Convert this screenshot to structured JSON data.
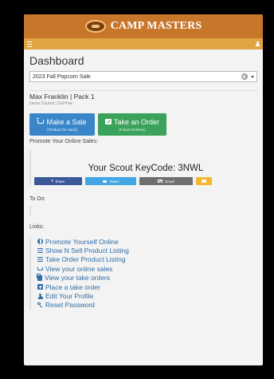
{
  "header": {
    "brand": "CAMP MASTERS"
  },
  "page": {
    "title": "Dashboard"
  },
  "sale_select": {
    "value": "2023 Fall Popcorn Sale"
  },
  "scout": {
    "name": "Max Franklin | Pack 1",
    "council": "Demo Council | Tall Pine"
  },
  "actions": {
    "make_sale": {
      "label": "Make a Sale",
      "sub": "(Product On Hand)"
    },
    "take_order": {
      "label": "Take an Order",
      "sub": "(Future Delivery)"
    }
  },
  "promote": {
    "label": "Promote Your Online Sales:",
    "keycode": "Your Scout KeyCode: 3NWL",
    "share_facebook": "Share",
    "share_twitter": "Tweet",
    "share_email": "Email"
  },
  "todo": {
    "label": "To Do:"
  },
  "links": {
    "label": "Links:",
    "items": [
      {
        "label": "Promote Yourself Online",
        "icon": "globe-icon"
      },
      {
        "label": "Show N Sell Product Listing",
        "icon": "list-icon"
      },
      {
        "label": "Take Order Product Listing",
        "icon": "list-icon"
      },
      {
        "label": "View your online sales",
        "icon": "cart-icon"
      },
      {
        "label": "View your take orders",
        "icon": "documents-icon"
      },
      {
        "label": "Place a take order",
        "icon": "plus-square-icon"
      },
      {
        "label": "Edit Your Profile",
        "icon": "user-icon"
      },
      {
        "label": "Reset Password",
        "icon": "key-icon"
      }
    ]
  },
  "colors": {
    "header_bg": "#c8762a",
    "nav_bg": "#e2a341",
    "primary_blue": "#3a86c8",
    "success_green": "#3aa25a",
    "facebook": "#3b5998",
    "twitter": "#42a7e6",
    "email": "#6f6f6f",
    "sms": "#f4b72f",
    "link": "#2f6ea8"
  }
}
